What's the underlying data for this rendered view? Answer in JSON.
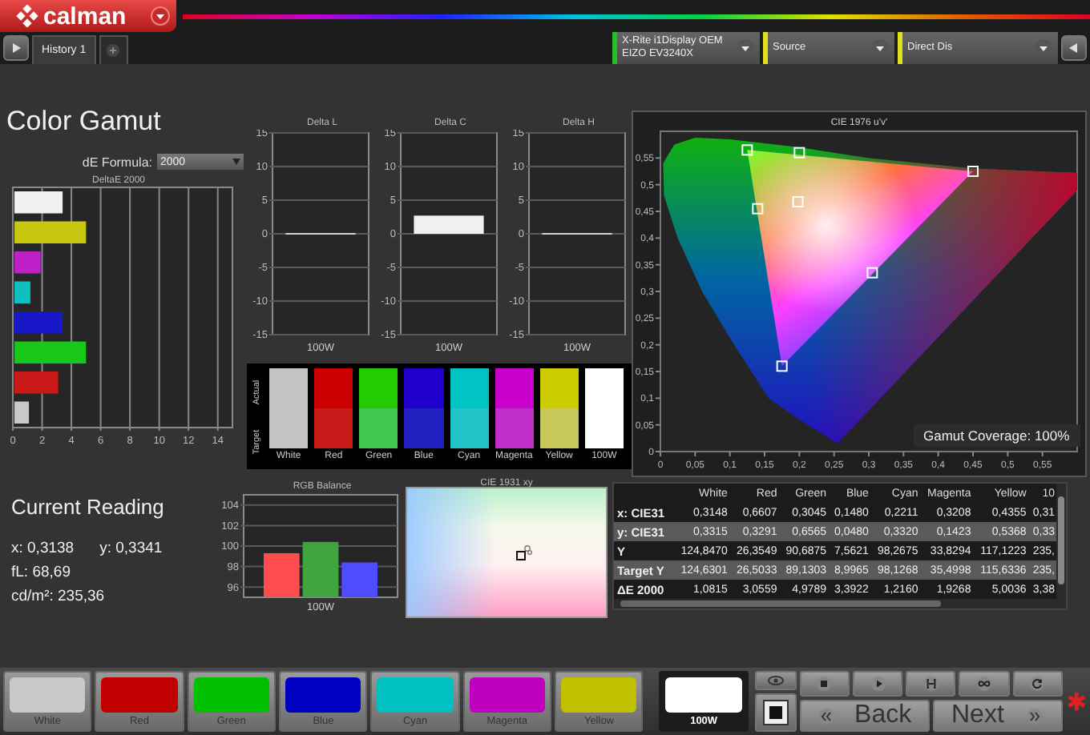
{
  "app": {
    "logo": "calman"
  },
  "tabs": {
    "items": [
      {
        "label": "History 1",
        "selected": true
      }
    ]
  },
  "devices": [
    {
      "lines": [
        "X-Rite i1Display OEM",
        "EIZO EV3240X"
      ],
      "color": "#22c022"
    },
    {
      "lines": [
        "Source"
      ],
      "color": "#e0e020"
    },
    {
      "lines": [
        "Direct Dis"
      ],
      "color": "#e0e020"
    }
  ],
  "page_title": "Color Gamut",
  "de_formula": {
    "label": "dE Formula:",
    "value": "2000"
  },
  "deltae_chart": {
    "chart_data": {
      "type": "bar",
      "orientation": "horizontal",
      "title": "DeltaE 2000",
      "grid": true,
      "xlim": [
        0,
        15
      ],
      "xticks": [
        0,
        2,
        4,
        6,
        8,
        10,
        12,
        14
      ],
      "series": [
        {
          "values": [
            3.4,
            5,
            1.9,
            1.2,
            3.4,
            5,
            3.1,
            1.1
          ]
        }
      ],
      "colors": [
        "#f0f0f0",
        "#c8c810",
        "#c020c8",
        "#10c0c0",
        "#1818c8",
        "#18c818",
        "#c81818",
        "#c8c8c8"
      ]
    }
  },
  "delta_charts": [
    {
      "chart_data": {
        "type": "bar",
        "title": "Delta L",
        "grid": true,
        "categories": [
          "100W"
        ],
        "ylim": [
          -15,
          15
        ],
        "yticks": [
          -15,
          -10,
          -5,
          0,
          5,
          10,
          15
        ],
        "series": [
          {
            "color": "#f0f0f0",
            "values": [
              0
            ]
          }
        ]
      }
    },
    {
      "chart_data": {
        "type": "bar",
        "title": "Delta C",
        "grid": true,
        "categories": [
          "100W"
        ],
        "ylim": [
          -15,
          15
        ],
        "yticks": [
          -15,
          -10,
          -5,
          0,
          5,
          10,
          15
        ],
        "series": [
          {
            "color": "#f0f0f0",
            "values": [
              2.7
            ]
          }
        ]
      }
    },
    {
      "chart_data": {
        "type": "bar",
        "title": "Delta H",
        "grid": true,
        "categories": [
          "100W"
        ],
        "ylim": [
          -15,
          15
        ],
        "yticks": [
          -15,
          -10,
          -5,
          0,
          5,
          10,
          15
        ],
        "series": [
          {
            "color": "#f0f0f0",
            "values": [
              0
            ]
          }
        ]
      }
    }
  ],
  "swatches": {
    "side_labels": [
      "Actual",
      "Target"
    ],
    "items": [
      {
        "label": "White",
        "actual": {
          "color": "#c4c4c4"
        },
        "target": {
          "color": "#c4c4c4"
        }
      },
      {
        "label": "Red",
        "actual": {
          "color": "#cc0000"
        },
        "target": {
          "color": "#c81c1c"
        }
      },
      {
        "label": "Green",
        "actual": {
          "color": "#22cc00"
        },
        "target": {
          "color": "#40c850"
        }
      },
      {
        "label": "Blue",
        "actual": {
          "color": "#2000cc"
        },
        "target": {
          "color": "#2020c0"
        }
      },
      {
        "label": "Cyan",
        "actual": {
          "color": "#00c4c4"
        },
        "target": {
          "color": "#20c4c8"
        }
      },
      {
        "label": "Magenta",
        "actual": {
          "color": "#cc00cc"
        },
        "target": {
          "color": "#c030c8"
        }
      },
      {
        "label": "Yellow",
        "actual": {
          "color": "#cccc00"
        },
        "target": {
          "color": "#c8c858"
        }
      },
      {
        "label": "100W",
        "actual": {
          "color": "#ffffff"
        },
        "target": {
          "color": "#ffffff"
        }
      }
    ]
  },
  "cie1976": {
    "gamut_coverage": "Gamut Coverage:  100%",
    "chart_data": {
      "type": "scatter",
      "title": "CIE 1976 u'v'",
      "xlim": [
        0,
        0.6
      ],
      "ylim": [
        0,
        0.6
      ],
      "xticks": [
        0,
        {
          "value": 0.05,
          "label": "0,05"
        },
        {
          "value": 0.1,
          "label": "0,1"
        },
        {
          "value": 0.15,
          "label": "0,15"
        },
        {
          "value": 0.2,
          "label": "0,2"
        },
        {
          "value": 0.25,
          "label": "0,25"
        },
        {
          "value": 0.3,
          "label": "0,3"
        },
        {
          "value": 0.35,
          "label": "0,35"
        },
        {
          "value": 0.4,
          "label": "0,4"
        },
        {
          "value": 0.45,
          "label": "0,45"
        },
        {
          "value": 0.5,
          "label": "0,5"
        },
        {
          "value": 0.55,
          "label": "0,55"
        }
      ],
      "yticks": [
        0,
        {
          "value": 0.05,
          "label": "0,05"
        },
        {
          "value": 0.1,
          "label": "0,1"
        },
        {
          "value": 0.15,
          "label": "0,15"
        },
        {
          "value": 0.2,
          "label": "0,2"
        },
        {
          "value": 0.25,
          "label": "0,25"
        },
        {
          "value": 0.3,
          "label": "0,3"
        },
        {
          "value": 0.35,
          "label": "0,35"
        },
        {
          "value": 0.4,
          "label": "0,4"
        },
        {
          "value": 0.45,
          "label": "0,45"
        },
        {
          "value": 0.5,
          "label": "0,5"
        },
        {
          "value": 0.55,
          "label": "0,55"
        }
      ],
      "x": [
        0.45,
        0.125,
        0.175,
        0.14,
        0.305,
        0.2,
        0.198
      ],
      "series": [
        {
          "color": "#ffffff",
          "values": [
            0.525,
            0.565,
            0.16,
            0.455,
            0.335,
            0.56,
            0.468
          ]
        }
      ]
    }
  },
  "current_reading": {
    "title": "Current Reading",
    "lines": [
      [
        "x: 0,3138",
        "y: 0,3341"
      ],
      [
        "fL: 68,69"
      ],
      [
        "cd/m²: 235,36"
      ]
    ]
  },
  "rgb_balance": {
    "chart_data": {
      "type": "bar",
      "title": "RGB Balance",
      "grid": true,
      "xlabel": "100W",
      "ylim": [
        95,
        105
      ],
      "yticks": [
        96,
        98,
        100,
        102,
        104
      ],
      "series": [
        {
          "values": [
            99.3,
            100.4,
            98.4
          ]
        }
      ],
      "colors": [
        "#ff4d4d",
        "#3fa63f",
        "#4d4dff"
      ]
    }
  },
  "cie1931": {
    "title": "CIE 1931 xy"
  },
  "table": {
    "columns": [
      "White",
      "Red",
      "Green",
      "Blue",
      "Cyan",
      "Magenta",
      "Yellow",
      "10"
    ],
    "rows": [
      {
        "label": "x: CIE31",
        "cells": [
          "0,3148",
          "0,6607",
          "0,3045",
          "0,1480",
          "0,2211",
          "0,3208",
          "0,4355",
          "0,31"
        ]
      },
      {
        "label": "y: CIE31",
        "cells": [
          "0,3315",
          "0,3291",
          "0,6565",
          "0,0480",
          "0,3320",
          "0,1423",
          "0,5368",
          "0,33"
        ]
      },
      {
        "label": "Y",
        "cells": [
          "124,8470",
          "26,3549",
          "90,6875",
          "7,5621",
          "98,2675",
          "33,8294",
          "117,1223",
          "235,"
        ]
      },
      {
        "label": "Target Y",
        "cells": [
          "124,6301",
          "26,5033",
          "89,1303",
          "8,9965",
          "98,1268",
          "35,4998",
          "115,6336",
          "235,"
        ]
      },
      {
        "label": "ΔE 2000",
        "cells": [
          "1,0815",
          "3,0559",
          "4,9789",
          "3,3922",
          "1,2160",
          "1,9268",
          "5,0036",
          "3,38"
        ]
      }
    ]
  },
  "patch_bar": {
    "items": [
      {
        "label": "White",
        "color": "#c8c8c8",
        "selected": false
      },
      {
        "label": "Red",
        "color": "#c00000",
        "selected": false
      },
      {
        "label": "Green",
        "color": "#00c000",
        "selected": false
      },
      {
        "label": "Blue",
        "color": "#0000c0",
        "selected": false
      },
      {
        "label": "Cyan",
        "color": "#00c0c0",
        "selected": false
      },
      {
        "label": "Magenta",
        "color": "#c000c0",
        "selected": false
      },
      {
        "label": "Yellow",
        "color": "#c0c000",
        "selected": false
      },
      {
        "label": "100W",
        "color": "#ffffff",
        "selected": true
      }
    ]
  },
  "nav": {
    "back": "Back",
    "next": "Next"
  }
}
